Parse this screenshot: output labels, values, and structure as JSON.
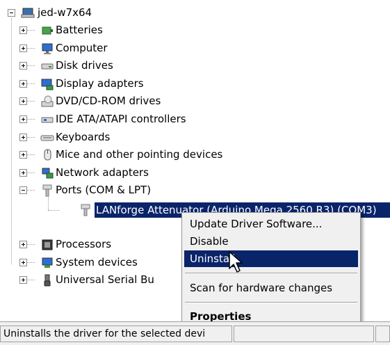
{
  "tree": {
    "root": {
      "label": "jed-w7x64",
      "icon": "computer-icon"
    },
    "categories": [
      {
        "label": "Batteries",
        "icon": "battery-icon"
      },
      {
        "label": "Computer",
        "icon": "monitor-icon"
      },
      {
        "label": "Disk drives",
        "icon": "disk-drive-icon"
      },
      {
        "label": "Display adapters",
        "icon": "display-adapter-icon"
      },
      {
        "label": "DVD/CD-ROM drives",
        "icon": "dvd-drive-icon"
      },
      {
        "label": "IDE ATA/ATAPI controllers",
        "icon": "ide-controller-icon"
      },
      {
        "label": "Keyboards",
        "icon": "keyboard-icon"
      },
      {
        "label": "Mice and other pointing devices",
        "icon": "mouse-icon"
      },
      {
        "label": "Network adapters",
        "icon": "network-adapter-icon"
      },
      {
        "label": "Ports (COM & LPT)",
        "icon": "port-icon"
      },
      {
        "label": "Processors",
        "icon": "processor-icon"
      },
      {
        "label": "System devices",
        "icon": "system-device-icon"
      },
      {
        "label": "Universal Serial Bu",
        "icon": "usb-icon"
      }
    ],
    "selected_child": {
      "label": "LANforge Attenuator (Arduino Mega 2560 R3) (COM3)",
      "icon": "port-icon"
    }
  },
  "context_menu": {
    "items": [
      {
        "label": "Update Driver Software..."
      },
      {
        "label": "Disable"
      },
      {
        "label": "Uninstall"
      },
      {
        "label": "Scan for hardware changes"
      },
      {
        "label": "Properties"
      }
    ],
    "highlighted": "Uninstall"
  },
  "status_bar": {
    "text": "Uninstalls the driver for the selected devi"
  },
  "colors": {
    "selection": "#0a246a",
    "menu_bg": "#f0f0f0"
  }
}
